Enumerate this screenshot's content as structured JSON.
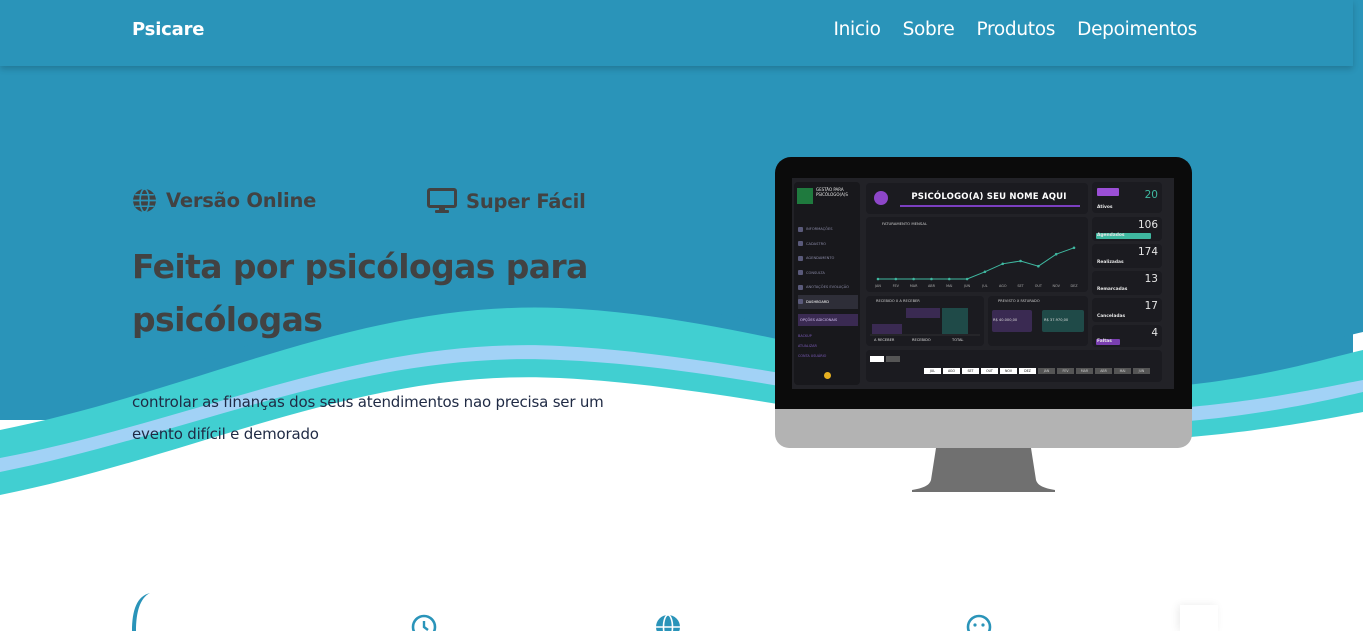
{
  "nav": {
    "brand": "Psicare",
    "links": [
      "Inicio",
      "Sobre",
      "Produtos",
      "Depoimentos"
    ]
  },
  "hero": {
    "features": [
      {
        "icon": "globe-icon",
        "label": "Versão Online"
      },
      {
        "icon": "monitor-icon",
        "label": "Super Fácil"
      }
    ],
    "headline": "Feita por psicólogas para psicólogas",
    "subtext": "controlar as finanças dos seus atendimentos nao precisa ser um evento difícil e demorado"
  },
  "dashboard": {
    "logo": "GESTÃO PARA PSICÓLOGO(A)S",
    "title": "PSICÓLOGO(A) SEU NOME AQUI",
    "sidebar": [
      "INFORMAÇÕES",
      "CADASTRO",
      "AGENDAMENTO",
      "CONSULTA",
      "ANOTAÇÕES EVOLUÇÃO",
      "DASHBOARD"
    ],
    "sidebar_extra": "OPÇÕES ADICIONAIS",
    "sidebar_sub": [
      "BACKUP",
      "ATUALIZAR",
      "CONTA USUÁRIO"
    ],
    "chart_title": "FATURAMENTO MENSAL",
    "card_recebido": "RECEBIDO X A RECEBER",
    "card_recebido_cols": [
      "A RECEBER",
      "RECEBIDO",
      "TOTAL"
    ],
    "card_previsto": "PREVISTO X FATURADO",
    "previsto_value": "R$ 40.000,00",
    "faturado_value": "R$ 37.970,00",
    "kpis": [
      {
        "label": "Ativos",
        "value": "20",
        "color": "#9b4fd6"
      },
      {
        "label": "Agendados",
        "value": "106",
        "color": "#3fb8a0"
      },
      {
        "label": "Realizadas",
        "value": "174",
        "color": "#4a4a56"
      },
      {
        "label": "Remarcadas",
        "value": "13",
        "color": "#6a6a74"
      },
      {
        "label": "Canceladas",
        "value": "17",
        "color": "#585862"
      },
      {
        "label": "Faltas",
        "value": "4",
        "color": "#7a3fb0"
      }
    ],
    "months": [
      "JUL",
      "AGO",
      "SET",
      "OUT",
      "NOV",
      "DEZ",
      "JAN",
      "FEV",
      "MAR",
      "ABR",
      "MAI",
      "JUN"
    ],
    "chart_months": [
      "JAN",
      "FEV",
      "MAR",
      "ABR",
      "MAI",
      "JUN",
      "JUL",
      "AGO",
      "SET",
      "OUT",
      "NOV",
      "DEZ"
    ]
  },
  "colors": {
    "nav": "#2a94b9",
    "wave_teal": "#41cfd1",
    "wave_light": "#a2d2f6",
    "text_dark": "#424242"
  },
  "bottom_icons": [
    "clock-icon",
    "globe-icon",
    "smile-icon"
  ]
}
